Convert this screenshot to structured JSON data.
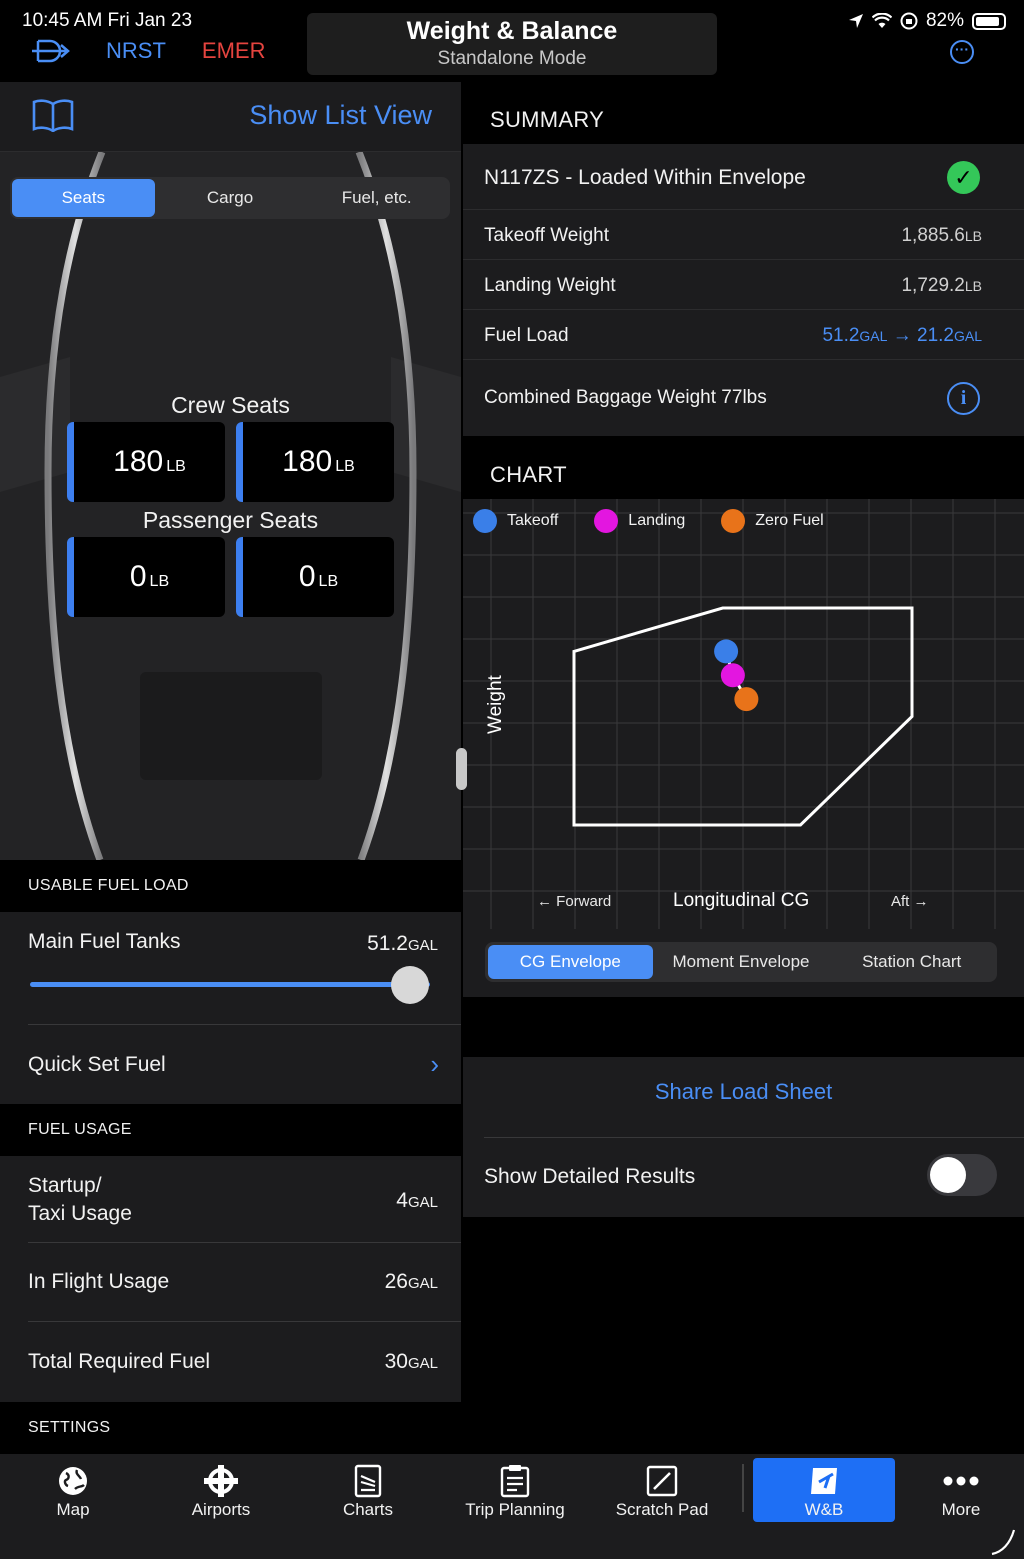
{
  "status": {
    "time_date": "10:45 AM   Fri Jan 23",
    "battery": "82%"
  },
  "topbar": {
    "nrst": "NRST",
    "emer": "EMER",
    "title": "Weight & Balance",
    "subtitle": "Standalone Mode"
  },
  "left": {
    "show_list": "Show List View",
    "tabs": [
      "Seats",
      "Cargo",
      "Fuel, etc."
    ],
    "crew_label": "Crew Seats",
    "passenger_label": "Passenger Seats",
    "seats": [
      {
        "value": "180",
        "unit": "LB"
      },
      {
        "value": "180",
        "unit": "LB"
      },
      {
        "value": "0",
        "unit": "LB"
      },
      {
        "value": "0",
        "unit": "LB"
      }
    ],
    "usable_fuel_header": "USABLE FUEL LOAD",
    "main_tanks_label": "Main Fuel Tanks",
    "main_tanks_value": "51.2",
    "main_tanks_unit": "GAL",
    "main_tanks_fill": 1.0,
    "quick_set": "Quick Set Fuel",
    "fuel_usage_header": "FUEL USAGE",
    "usage_rows": [
      {
        "label1": "Startup/",
        "label2": "Taxi Usage",
        "value": "4",
        "unit": "GAL"
      },
      {
        "label": "In Flight Usage",
        "value": "26",
        "unit": "GAL"
      },
      {
        "label": "Total Required Fuel",
        "value": "30",
        "unit": "GAL"
      }
    ],
    "settings_header": "SETTINGS"
  },
  "summary": {
    "header": "SUMMARY",
    "status": "N117ZS - Loaded Within Envelope",
    "takeoff_label": "Takeoff Weight",
    "takeoff_value": "1,885.6",
    "landing_label": "Landing Weight",
    "landing_value": "1,729.2",
    "weight_unit": "LB",
    "fuel_label": "Fuel Load",
    "fuel_from": "51.2",
    "fuel_to": "21.2",
    "fuel_unit": "GAL",
    "fuel_arrow": "→",
    "baggage": "Combined Baggage Weight 77lbs"
  },
  "chart": {
    "header": "CHART",
    "legend": [
      {
        "label": "Takeoff",
        "color": "#3a7fe8"
      },
      {
        "label": "Landing",
        "color": "#e316e0"
      },
      {
        "label": "Zero Fuel",
        "color": "#e8731a"
      }
    ],
    "y_label": "Weight",
    "x_label": "Longitudinal CG",
    "forward": "← Forward",
    "aft": "Aft →",
    "tabs": [
      "CG Envelope",
      "Moment Envelope",
      "Station Chart"
    ]
  },
  "chart_data": {
    "type": "scatter",
    "title": "",
    "xlabel": "Longitudinal CG",
    "ylabel": "Weight",
    "series": [
      {
        "name": "Takeoff",
        "points": [
          [
            0.45,
            0.8
          ]
        ]
      },
      {
        "name": "Landing",
        "points": [
          [
            0.47,
            0.69
          ]
        ]
      },
      {
        "name": "Zero Fuel",
        "points": [
          [
            0.51,
            0.58
          ]
        ]
      }
    ],
    "envelope": [
      [
        0,
        0.8
      ],
      [
        0.44,
        1.0
      ],
      [
        1.0,
        1.0
      ],
      [
        1.0,
        0.5
      ],
      [
        0.67,
        0.0
      ],
      [
        0,
        0.0
      ]
    ],
    "grid": true
  },
  "actions": {
    "share": "Share Load Sheet",
    "detailed": "Show Detailed Results"
  },
  "tabbar": [
    {
      "label": "Map",
      "icon": "globe-icon"
    },
    {
      "label": "Airports",
      "icon": "airport-icon"
    },
    {
      "label": "Charts",
      "icon": "charts-icon"
    },
    {
      "label": "Trip Planning",
      "icon": "trip-planning-icon"
    },
    {
      "label": "Scratch Pad",
      "icon": "scratch-pad-icon"
    },
    {
      "label": "W&B",
      "icon": "weight-balance-icon"
    },
    {
      "label": "More",
      "icon": "more-icon"
    }
  ]
}
